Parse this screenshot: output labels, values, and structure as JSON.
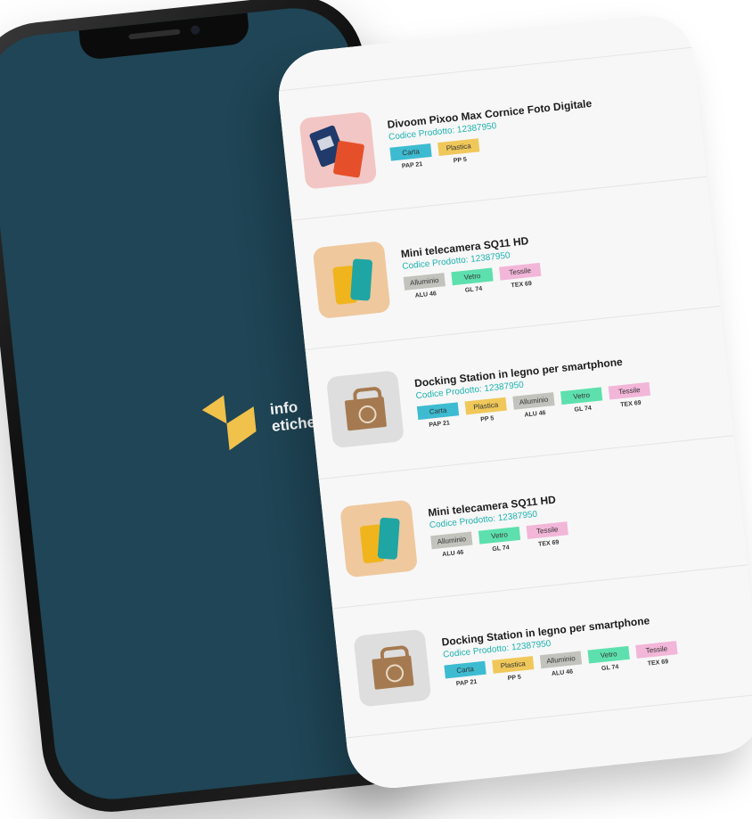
{
  "splash": {
    "logo_line1": "info",
    "logo_line2": "etichetta",
    "colors": {
      "background": "#1f4556",
      "logo": "#f0c14b"
    }
  },
  "tag_colors": {
    "Carta": "#3dbbd1",
    "Plastica": "#f0c85a",
    "Alluminio": "#c3c3bd",
    "Vetro": "#5de0ad",
    "Tessile": "#f2b6d8"
  },
  "products": [
    {
      "name": "Divoom Pixoo Max Cornice Foto Digitale",
      "code": "Codice Prodotto: 12387950",
      "thumb": "pink",
      "tags": [
        {
          "label": "Carta",
          "code": "PAP 21"
        },
        {
          "label": "Plastica",
          "code": "PP 5"
        }
      ]
    },
    {
      "name": "Mini telecamera SQ11 HD",
      "code": "Codice Prodotto: 12387950",
      "thumb": "peach",
      "tags": [
        {
          "label": "Alluminio",
          "code": "ALU 46"
        },
        {
          "label": "Vetro",
          "code": "GL 74"
        },
        {
          "label": "Tessile",
          "code": "TEX 69"
        }
      ]
    },
    {
      "name": "Docking Station in legno per smartphone",
      "code": "Codice Prodotto: 12387950",
      "thumb": "grey",
      "tags": [
        {
          "label": "Carta",
          "code": "PAP 21"
        },
        {
          "label": "Plastica",
          "code": "PP 5"
        },
        {
          "label": "Alluminio",
          "code": "ALU 46"
        },
        {
          "label": "Vetro",
          "code": "GL 74"
        },
        {
          "label": "Tessile",
          "code": "TEX 69"
        }
      ]
    },
    {
      "name": "Mini telecamera SQ11 HD",
      "code": "Codice Prodotto: 12387950",
      "thumb": "peach",
      "tags": [
        {
          "label": "Alluminio",
          "code": "ALU 46"
        },
        {
          "label": "Vetro",
          "code": "GL 74"
        },
        {
          "label": "Tessile",
          "code": "TEX 69"
        }
      ]
    },
    {
      "name": "Docking Station in legno per smartphone",
      "code": "Codice Prodotto: 12387950",
      "thumb": "grey",
      "tags": [
        {
          "label": "Carta",
          "code": "PAP 21"
        },
        {
          "label": "Plastica",
          "code": "PP 5"
        },
        {
          "label": "Alluminio",
          "code": "ALU 46"
        },
        {
          "label": "Vetro",
          "code": "GL 74"
        },
        {
          "label": "Tessile",
          "code": "TEX 69"
        }
      ]
    }
  ]
}
